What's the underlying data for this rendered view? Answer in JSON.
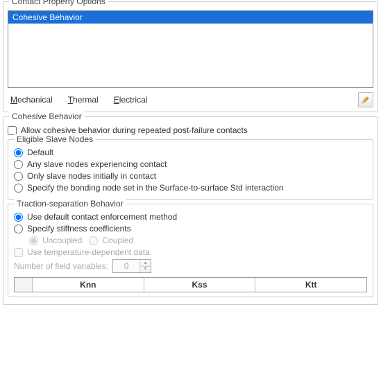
{
  "options_section": {
    "legend": "Contact Property Options",
    "items": [
      "Cohesive Behavior"
    ],
    "selected_index": 0,
    "tabs": {
      "mechanical": "Mechanical",
      "thermal": "Thermal",
      "electrical": "Electrical"
    }
  },
  "cohesive_section": {
    "legend": "Cohesive Behavior",
    "allow_repeated_label": "Allow cohesive behavior during repeated post-failure contacts",
    "eligible": {
      "legend": "Eligible Slave Nodes",
      "opt_default": "Default",
      "opt_any": "Any slave nodes experiencing contact",
      "opt_initial": "Only slave nodes initially in contact",
      "opt_specify": "Specify the bonding node set in the Surface-to-surface Std interaction"
    },
    "traction": {
      "legend": "Traction-separation Behavior",
      "opt_default_method": "Use default contact enforcement method",
      "opt_specify_stiff": "Specify stiffness coefficients",
      "sub_uncoupled": "Uncoupled",
      "sub_coupled": "Coupled",
      "use_temp_label": "Use temperature-dependent data",
      "num_field_vars_label": "Number of field variables:",
      "num_field_vars_value": "0",
      "cols": {
        "knn": "Knn",
        "kss": "Kss",
        "ktt": "Ktt"
      }
    }
  }
}
